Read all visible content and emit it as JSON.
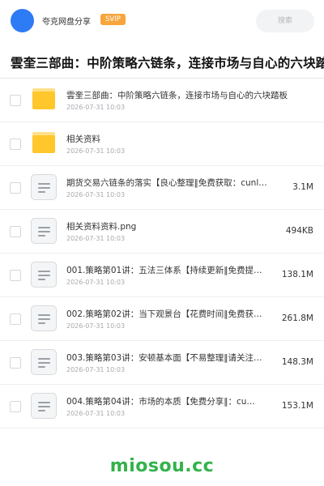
{
  "header": {
    "user_name": "夸克网盘分享",
    "vip_label": "SVIP",
    "search_placeholder": "搜索"
  },
  "folder": {
    "title": "雲奎三部曲：中阶策略六链条，连接市场与自心的六块踏板"
  },
  "files": [
    {
      "type": "folder",
      "name": "雲奎三部曲：中阶策略六链条，连接市场与自心的六块踏板",
      "date": "2026-07-31 10:03",
      "size": ""
    },
    {
      "type": "folder",
      "name": "相关资料",
      "date": "2026-07-31 10:03",
      "size": ""
    },
    {
      "type": "file",
      "name": "期货交易六链条的落实【良心整理‖免费获取：cunl…",
      "date": "2026-07-31 10:03",
      "size": "3.1M"
    },
    {
      "type": "file",
      "name": "相关资料资料.png",
      "date": "2026-07-31 10:03",
      "size": "494KB"
    },
    {
      "type": "file",
      "name": "001.策略第01讲：五法三体系【持续更新‖免费提…",
      "date": "2026-07-31 10:03",
      "size": "138.1M"
    },
    {
      "type": "file",
      "name": "002.策略第02讲：当下观景台【花费时间‖免费获…",
      "date": "2026-07-31 10:03",
      "size": "261.8M"
    },
    {
      "type": "file",
      "name": "003.策略第03讲：安顿基本面【不易整理‖请关注…",
      "date": "2026-07-31 10:03",
      "size": "148.3M"
    },
    {
      "type": "file",
      "name": "004.策略第04讲：市场的本质【免费分享‖：cu…",
      "date": "2026-07-31 10:03",
      "size": "153.1M"
    }
  ],
  "icons": {
    "folder": "folder-icon",
    "file": "document-icon"
  },
  "colors": {
    "avatar": "#2e7bf6",
    "vip": "#f7a53c",
    "folder": "#ffc72c",
    "watermark": "#33b24a"
  },
  "watermark": "miosou.cc"
}
